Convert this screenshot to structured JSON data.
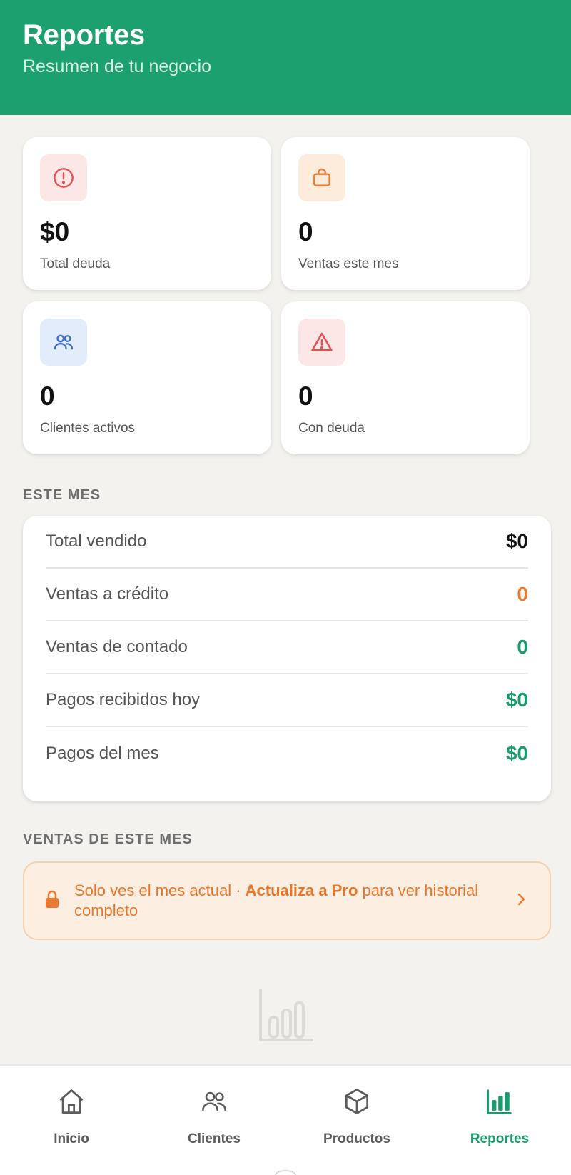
{
  "header": {
    "title": "Reportes",
    "subtitle": "Resumen de tu negocio"
  },
  "stats": [
    {
      "value": "$0",
      "label": "Total deuda",
      "icon": "alert-circle-icon",
      "color": "#e15151"
    },
    {
      "value": "0",
      "label": "Ventas este mes",
      "icon": "shopping-bag-icon",
      "color": "#ea7a30"
    },
    {
      "value": "0",
      "label": "Clientes activos",
      "icon": "users-icon",
      "color": "#3f6fc7"
    },
    {
      "value": "0",
      "label": "Con deuda",
      "icon": "warning-triangle-icon",
      "color": "#e15151"
    }
  ],
  "this_month": {
    "section_label": "ESTE MES",
    "rows": [
      {
        "label": "Total vendido",
        "value": "$0"
      },
      {
        "label": "Ventas a crédito",
        "value": "0"
      },
      {
        "label": "Ventas de contado",
        "value": "0"
      },
      {
        "label": "Pagos recibidos hoy",
        "value": "$0"
      },
      {
        "label": "Pagos del mes",
        "value": "$0"
      }
    ]
  },
  "sales_month": {
    "section_label": "VENTAS DE ESTE MES",
    "banner_text_before": "Solo ves el mes actual · ",
    "banner_link": "Actualiza a Pro",
    "banner_text_after": " para ver historial completo"
  },
  "nav": [
    {
      "label": "Inicio",
      "icon": "home-icon"
    },
    {
      "label": "Clientes",
      "icon": "users-icon"
    },
    {
      "label": "Productos",
      "icon": "box-icon"
    },
    {
      "label": "Reportes",
      "icon": "bar-chart-icon",
      "active": true
    }
  ],
  "colors": {
    "brand": "#1ba06e",
    "accent_orange": "#ea7a30",
    "accent_green": "#1a9b6c",
    "danger": "#e15151"
  }
}
